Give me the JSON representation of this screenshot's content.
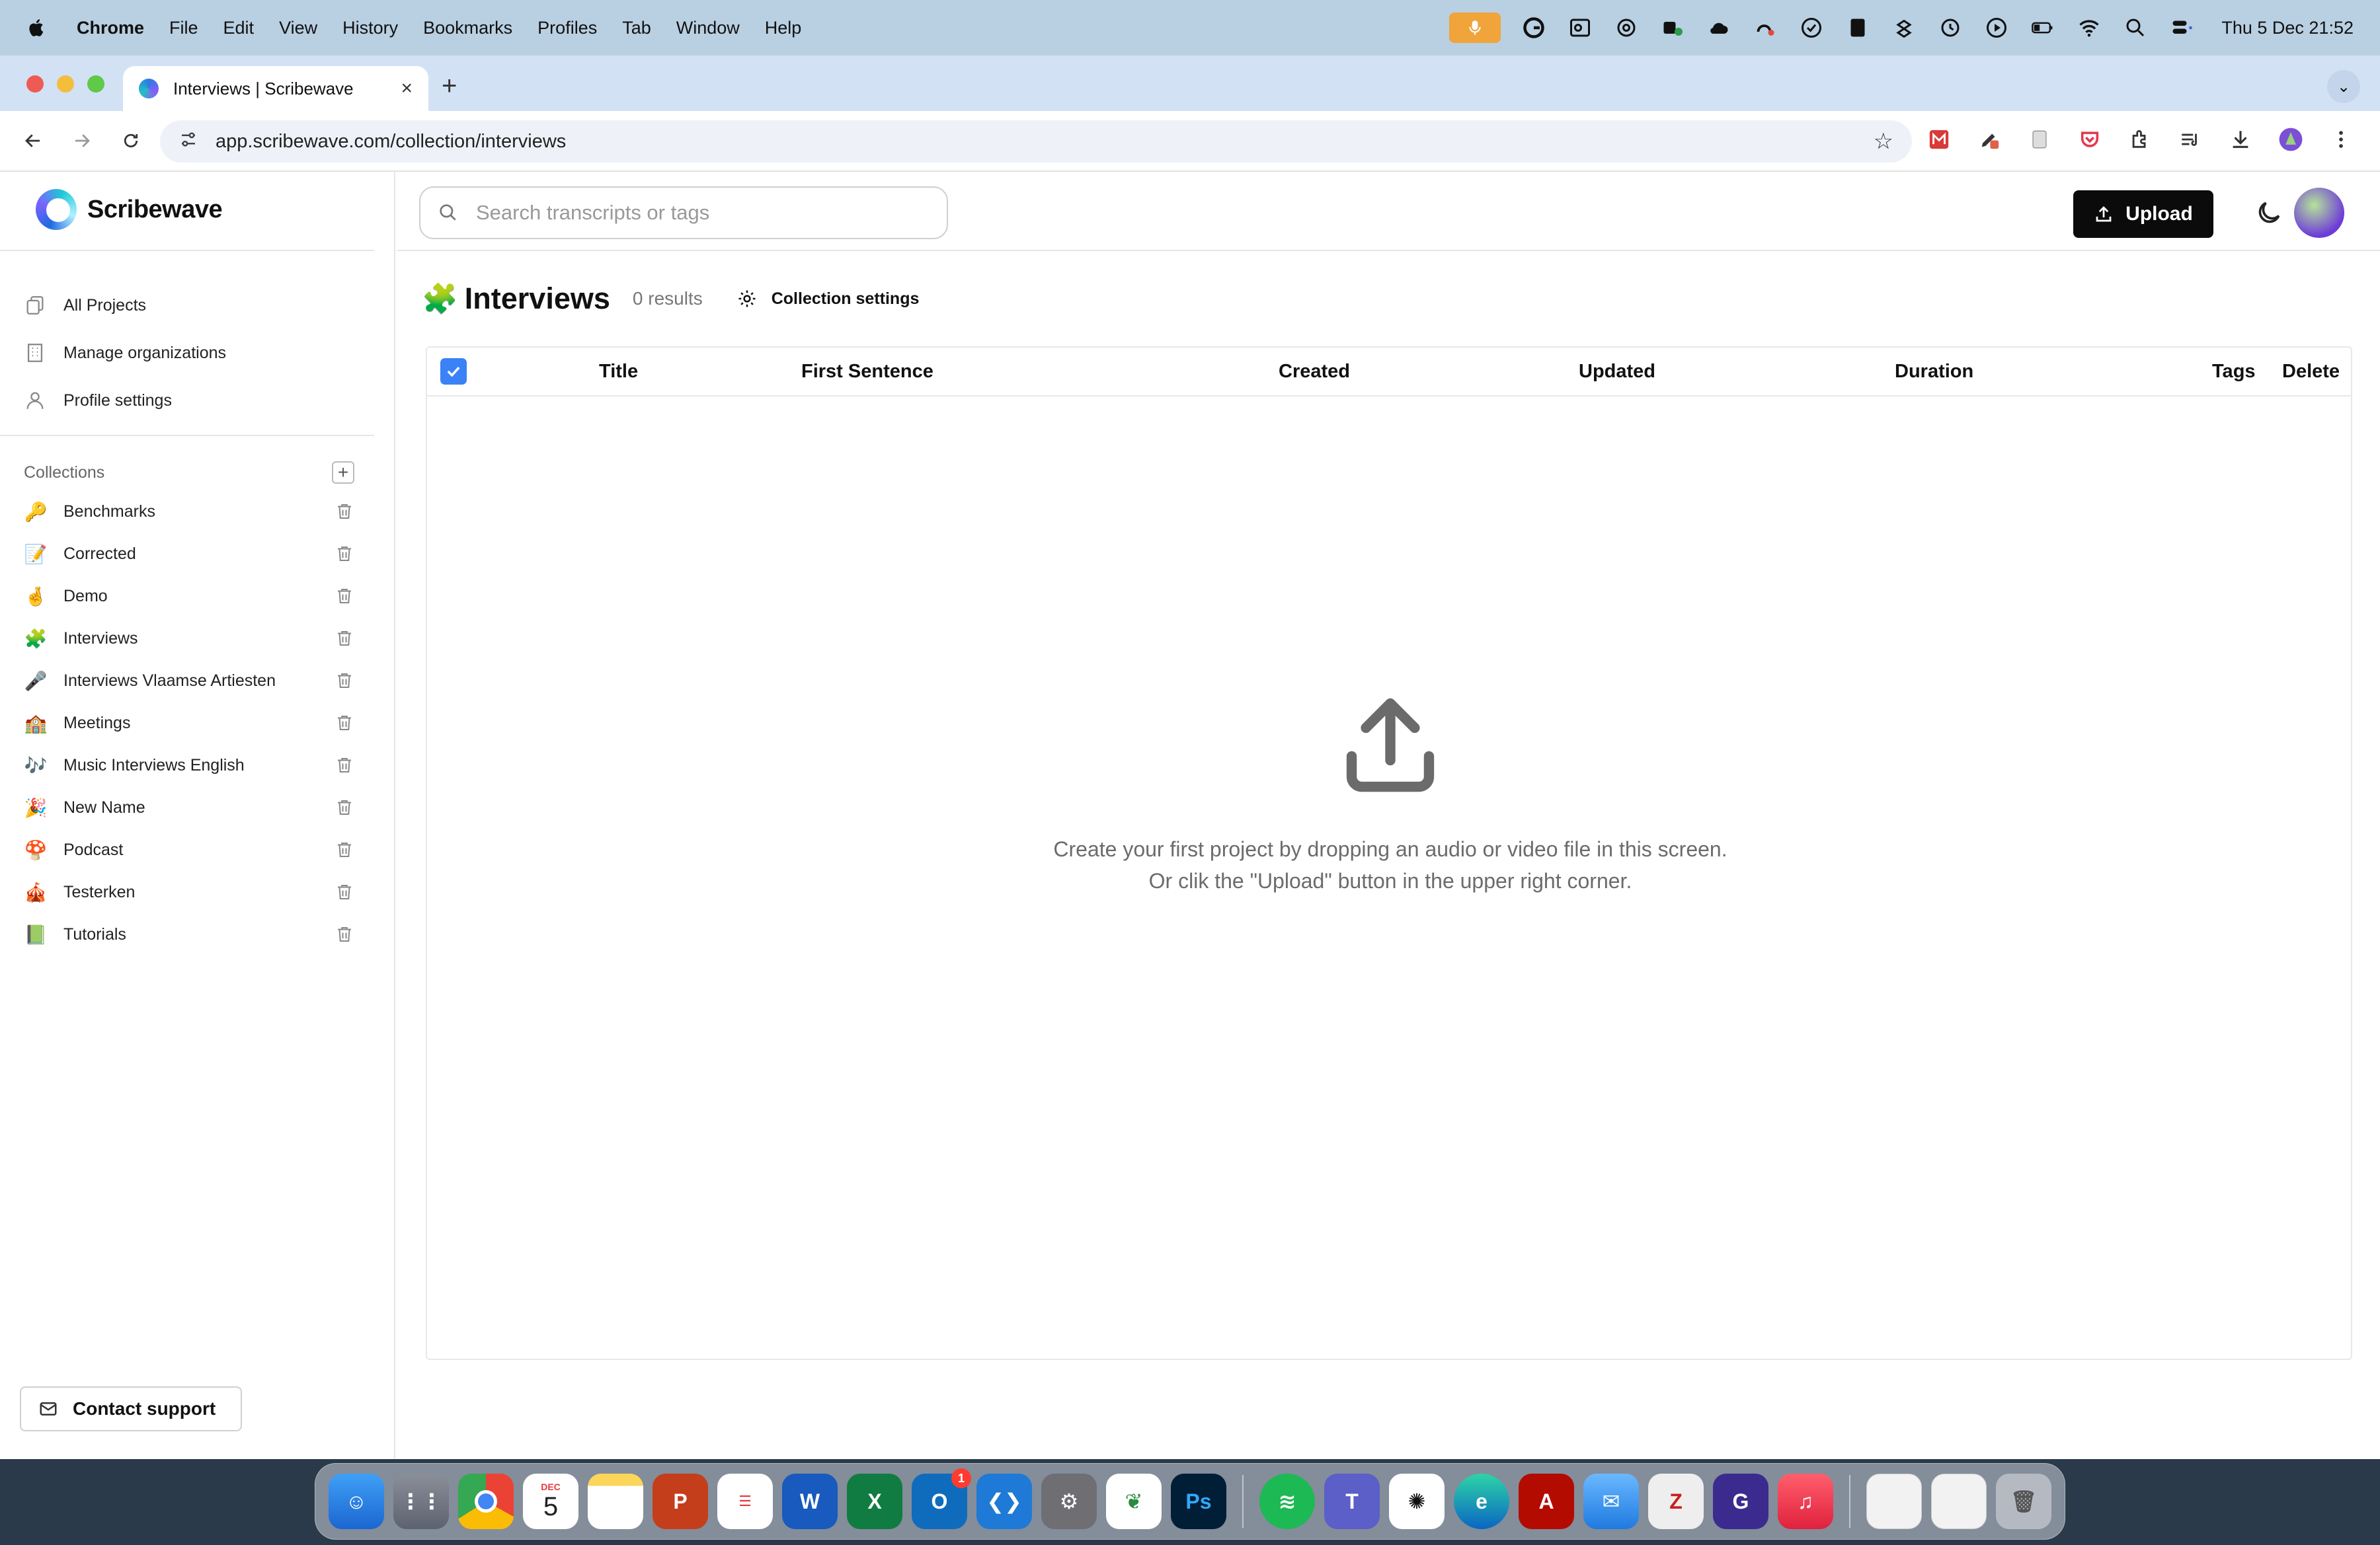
{
  "menubar": {
    "app_name": "Chrome",
    "items": [
      "File",
      "Edit",
      "View",
      "History",
      "Bookmarks",
      "Profiles",
      "Tab",
      "Window",
      "Help"
    ],
    "clock": "Thu 5 Dec  21:52"
  },
  "browser": {
    "tab_title": "Interviews | Scribewave",
    "url": "app.scribewave.com/collection/interviews"
  },
  "sidebar": {
    "brand": "Scribewave",
    "nav": [
      {
        "label": "All Projects",
        "icon": "copy-icon"
      },
      {
        "label": "Manage organizations",
        "icon": "building-icon"
      },
      {
        "label": "Profile settings",
        "icon": "user-icon"
      }
    ],
    "collections_label": "Collections",
    "collections": [
      {
        "emoji": "🔑",
        "label": "Benchmarks"
      },
      {
        "emoji": "📝",
        "label": "Corrected"
      },
      {
        "emoji": "🤞",
        "label": "Demo"
      },
      {
        "emoji": "🧩",
        "label": "Interviews"
      },
      {
        "emoji": "🎤",
        "label": "Interviews Vlaamse Artiesten"
      },
      {
        "emoji": "🏫",
        "label": "Meetings"
      },
      {
        "emoji": "🎶",
        "label": "Music Interviews English"
      },
      {
        "emoji": "🎉",
        "label": "New Name"
      },
      {
        "emoji": "🍄",
        "label": "Podcast"
      },
      {
        "emoji": "🎪",
        "label": "Testerken"
      },
      {
        "emoji": "📗",
        "label": "Tutorials"
      }
    ],
    "support_label": "Contact support"
  },
  "main": {
    "search_placeholder": "Search transcripts or tags",
    "upload_label": "Upload",
    "page_emoji": "🧩",
    "page_title": "Interviews",
    "results": "0 results",
    "collection_settings": "Collection settings",
    "columns": [
      "Title",
      "First Sentence",
      "Created",
      "Updated",
      "Duration",
      "Tags",
      "Delete"
    ],
    "empty_line1": "Create your first project by dropping an audio or video file in this screen.",
    "empty_line2": "Or clik the \"Upload\" button in the upper right corner."
  },
  "dock": {
    "calendar_month": "DEC",
    "calendar_day": "5",
    "outlook_badge": "1"
  },
  "colors": {
    "accent": "#3b82f6",
    "primary_button": "#0b0b0b",
    "menubar": "#b9cfe2",
    "tabbar": "#d3e1f5"
  }
}
